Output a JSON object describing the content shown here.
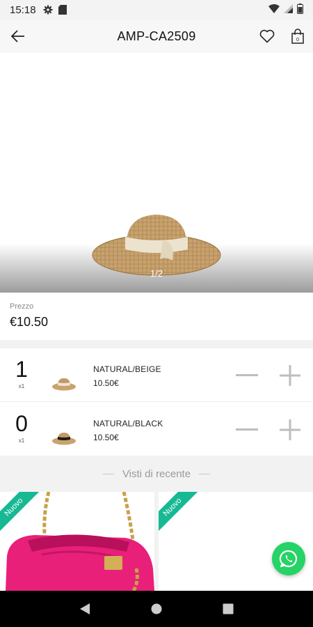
{
  "status_bar": {
    "time": "15:18"
  },
  "app_bar": {
    "title": "AMP-CA2509",
    "cart_count": "0"
  },
  "gallery": {
    "pager": "1/2"
  },
  "price": {
    "label": "Prezzo",
    "value": "€10.50"
  },
  "variants": [
    {
      "qty": "1",
      "unit": "x1",
      "name": "NATURAL/BEIGE",
      "price": "10.50€",
      "band_color": "#efe6d2"
    },
    {
      "qty": "0",
      "unit": "x1",
      "name": "NATURAL/BLACK",
      "price": "10.50€",
      "band_color": "#1c1c1c"
    }
  ],
  "recent": {
    "title": "Visti di recente",
    "cards": [
      {
        "badge": "Nuovo"
      },
      {
        "badge": "Nuovo"
      }
    ]
  },
  "colors": {
    "badge": "#17b994",
    "whatsapp": "#25d366",
    "bag": "#e8207a"
  }
}
